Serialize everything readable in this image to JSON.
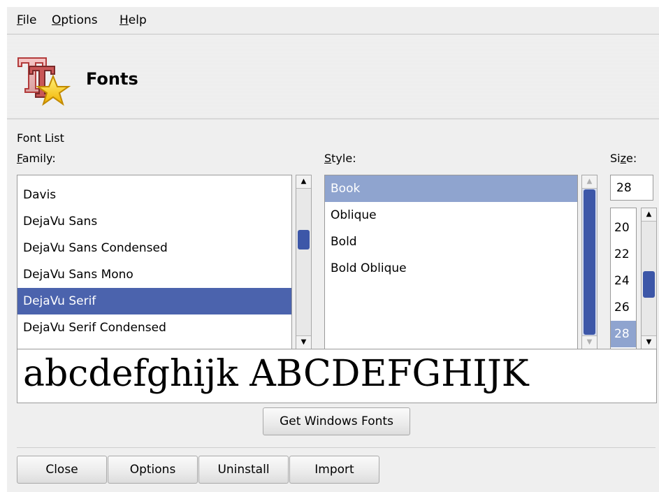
{
  "menu": [
    {
      "mnemonic": "F",
      "rest": "ile"
    },
    {
      "mnemonic": "O",
      "rest": "ptions"
    },
    {
      "mnemonic": "H",
      "rest": "elp"
    }
  ],
  "header": {
    "title": "Fonts",
    "icon": "fonts-app-icon"
  },
  "font_list": {
    "group_label": "Font List",
    "family_label_mnemonic": "F",
    "family_label_rest": "amily:",
    "style_label_mnemonic": "S",
    "style_label_rest": "tyle:",
    "size_label_pre": "Si",
    "size_label_mnemonic": "z",
    "size_label_rest": "e:"
  },
  "families": {
    "items": [
      "Davis",
      "DejaVu Sans",
      "DejaVu Sans Condensed",
      "DejaVu Sans Mono",
      "DejaVu Serif",
      "DejaVu Serif Condensed"
    ],
    "selected": "DejaVu Serif"
  },
  "styles": {
    "items": [
      "Book",
      "Oblique",
      "Bold",
      "Bold Oblique"
    ],
    "selected": "Book"
  },
  "sizes": {
    "current": "28",
    "items": [
      "20",
      "22",
      "24",
      "26",
      "28"
    ],
    "selected": "28"
  },
  "preview_text": "abcdefghijk ABCDEFGHIJK",
  "buttons": {
    "get_windows_fonts": "Get Windows Fonts",
    "close": "Close",
    "options": "Options",
    "uninstall": "Uninstall",
    "import": "Import"
  },
  "colors": {
    "selection": "#4b63ad",
    "selection_light": "#8fa4cf",
    "scroll_thumb": "#3d57a8"
  }
}
